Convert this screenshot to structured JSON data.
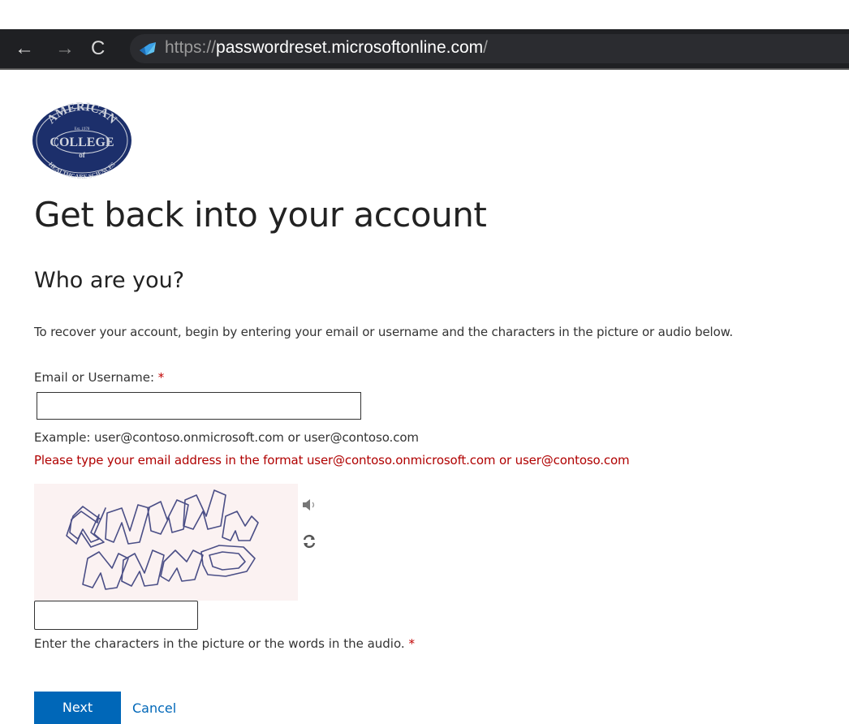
{
  "browser": {
    "back_glyph": "←",
    "forward_glyph": "→",
    "reload_glyph": "C",
    "url_scheme": "https://",
    "url_host": "passwordreset.microsoftonline.com",
    "url_slash": "/"
  },
  "logo": {
    "alt": "American College of Healthcare Sciences",
    "top_text": "AMERICAN",
    "middle_text": "COLLEGE",
    "of_text": "of",
    "bottom_text": "HEALTHCARE SCIENCES",
    "est_text": "Est. 1978",
    "colors": {
      "navy": "#1c2f6b",
      "silver": "#cfd3dc"
    }
  },
  "page": {
    "title": "Get back into your account",
    "subtitle": "Who are you?",
    "intro": "To recover your account, begin by entering your email or username and the characters in the picture or audio below.",
    "email_label": "Email or Username: ",
    "required_mark": "*",
    "email_value": "",
    "example": "Example: user@contoso.onmicrosoft.com or user@contoso.com",
    "error": "Please type your email address in the format user@contoso.onmicrosoft.com or user@contoso.com",
    "captcha_text": "4NMW 4N4P",
    "captcha_value": "",
    "captcha_help": "Enter the characters in the picture or the words in the audio. ",
    "next_label": "Next",
    "cancel_label": "Cancel"
  },
  "icons": {
    "audio": "speaker-icon",
    "refresh": "refresh-icon"
  },
  "colors": {
    "primary": "#0067b8",
    "error": "#b00000",
    "required": "#c00000"
  }
}
